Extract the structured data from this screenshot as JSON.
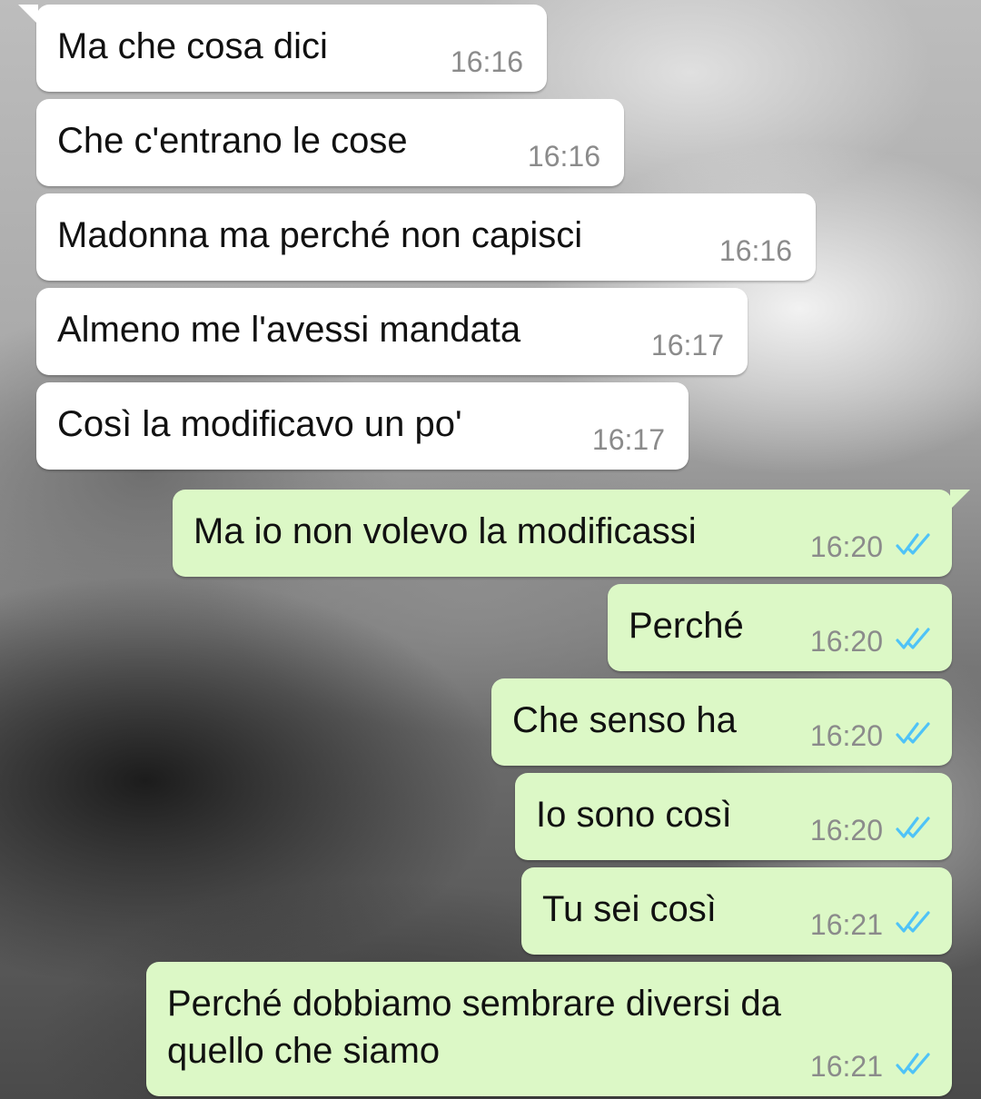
{
  "conversation": {
    "messages": [
      {
        "dir": "in",
        "text": "Ma che cosa dici",
        "time": "16:16"
      },
      {
        "dir": "in",
        "text": "Che c'entrano le cose",
        "time": "16:16"
      },
      {
        "dir": "in",
        "text": "Madonna ma perché non capisci",
        "time": "16:16"
      },
      {
        "dir": "in",
        "text": "Almeno me l'avessi mandata",
        "time": "16:17"
      },
      {
        "dir": "in",
        "text": "Così la modificavo un po'",
        "time": "16:17"
      },
      {
        "dir": "out",
        "text": "Ma io non volevo la modificassi",
        "time": "16:20",
        "status": "read"
      },
      {
        "dir": "out",
        "text": "Perché",
        "time": "16:20",
        "status": "read"
      },
      {
        "dir": "out",
        "text": "Che senso ha",
        "time": "16:20",
        "status": "read"
      },
      {
        "dir": "out",
        "text": "Io sono così",
        "time": "16:20",
        "status": "read"
      },
      {
        "dir": "out",
        "text": "Tu  sei così",
        "time": "16:21",
        "status": "read"
      },
      {
        "dir": "out",
        "text": "Perché dobbiamo sembrare diversi da quello che siamo",
        "time": "16:21",
        "status": "read"
      }
    ]
  },
  "colors": {
    "incoming_bubble": "#ffffff",
    "outgoing_bubble": "#dcf8c6",
    "read_ticks": "#4fc3f7",
    "timestamp": "#8b8b8b"
  },
  "icons": {
    "read_status": "double-check-icon"
  }
}
